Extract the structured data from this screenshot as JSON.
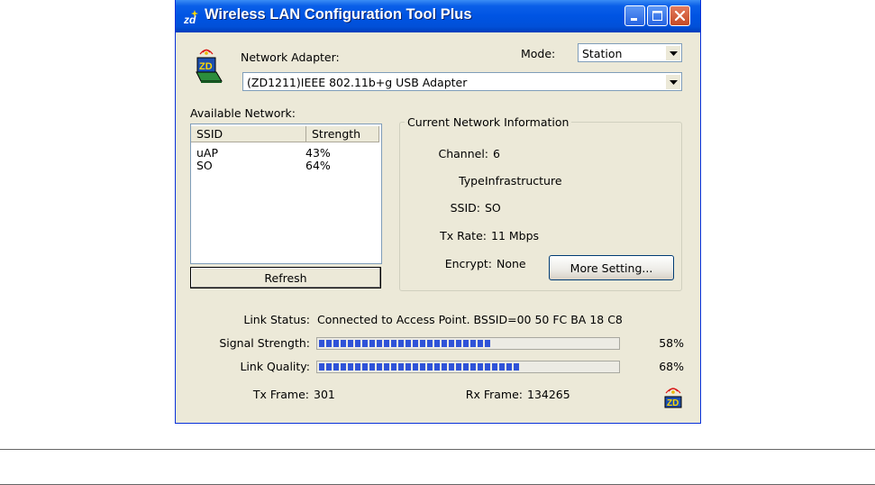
{
  "window": {
    "title": "Wireless LAN Configuration Tool Plus",
    "logo_icon": "zd-wireless-logo-icon",
    "controls": [
      "minimize-icon",
      "maximize-icon",
      "close-icon"
    ]
  },
  "adapter": {
    "label": "Network Adapter:",
    "value": "(ZD1211)IEEE 802.11b+g USB Adapter",
    "icon": "wireless-adapter-icon"
  },
  "mode": {
    "label": "Mode:",
    "value": "Station"
  },
  "available": {
    "label": "Available Network:",
    "columns": [
      "SSID",
      "Strength"
    ],
    "rows": [
      {
        "ssid": "uAP",
        "strength": "43%"
      },
      {
        "ssid": "SO",
        "strength": "64%"
      }
    ],
    "refresh_label": "Refresh"
  },
  "current": {
    "title": "Current Network Information",
    "channel_label": "Channel:",
    "channel": "6",
    "type_label": "Type:",
    "type": "Infrastructure",
    "ssid_label": "SSID:",
    "ssid": "SO",
    "txrate_label": "Tx Rate:",
    "txrate": "11 Mbps",
    "encrypt_label": "Encrypt:",
    "encrypt": "None",
    "more_label": "More Setting..."
  },
  "status": {
    "link_status_label": "Link Status:",
    "link_status": "Connected to Access Point. BSSID=00 50 FC BA 18 C8",
    "signal_label": "Signal Strength:",
    "signal_text": "58%",
    "signal_value": 58,
    "quality_label": "Link Quality:",
    "quality_text": "68%",
    "quality_value": 68,
    "tx_label": "Tx Frame:",
    "tx": "301",
    "rx_label": "Rx Frame:",
    "rx": "134265",
    "tray_icon": "zd-signal-icon"
  },
  "colors": {
    "titlebar": "#0054e3",
    "progress": "#2f53d8",
    "window_bg": "#ece9d8"
  }
}
